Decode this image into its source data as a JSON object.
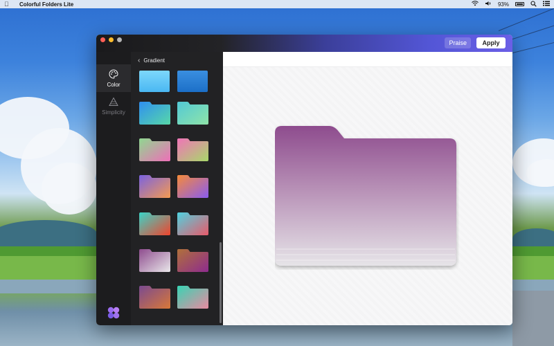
{
  "menubar": {
    "app_name": "Colorful Folders Lite",
    "battery": "93%"
  },
  "window": {
    "praise_label": "Praise",
    "apply_label": "Apply"
  },
  "rail": {
    "items": [
      {
        "label": "Color",
        "icon": "palette-icon",
        "active": true
      },
      {
        "label": "Simplicity",
        "icon": "triangle-outline-icon",
        "active": false
      }
    ]
  },
  "panel": {
    "header": "Gradient",
    "swatches": [
      {
        "kind": "flat",
        "from": "#7dd8fb",
        "to": "#4ab7f2"
      },
      {
        "kind": "flat",
        "from": "#3a8fe0",
        "to": "#1c6fc8"
      },
      {
        "kind": "folder",
        "from": "#2f8ff0",
        "to": "#57d8a8"
      },
      {
        "kind": "folder",
        "from": "#52c9d6",
        "to": "#8fe4a8"
      },
      {
        "kind": "folder",
        "from": "#8fd890",
        "to": "#ee6fb8"
      },
      {
        "kind": "folder",
        "from": "#f074b8",
        "to": "#a8d86a"
      },
      {
        "kind": "folder",
        "from": "#7a62e0",
        "to": "#f49a52"
      },
      {
        "kind": "folder",
        "from": "#f58a3a",
        "to": "#8a5cf0"
      },
      {
        "kind": "folder",
        "from": "#3ad4c8",
        "to": "#f0442c"
      },
      {
        "kind": "folder",
        "from": "#4fd2e0",
        "to": "#e85a6a"
      },
      {
        "kind": "folder",
        "from": "#8e4c8e",
        "to": "#e9e7ea"
      },
      {
        "kind": "folder",
        "from": "#b0703a",
        "to": "#8e2c8e"
      },
      {
        "kind": "folder",
        "from": "#7a4a90",
        "to": "#d87838"
      },
      {
        "kind": "folder",
        "from": "#38d4b4",
        "to": "#e88aa0"
      }
    ]
  },
  "preview": {
    "folder_top": "#8e4c8e",
    "folder_bottom": "#e6e4e8"
  },
  "colors": {
    "titlebar_accent": "#5356d6",
    "rail_bg": "#1c1c1e",
    "panel_bg": "#222224"
  }
}
